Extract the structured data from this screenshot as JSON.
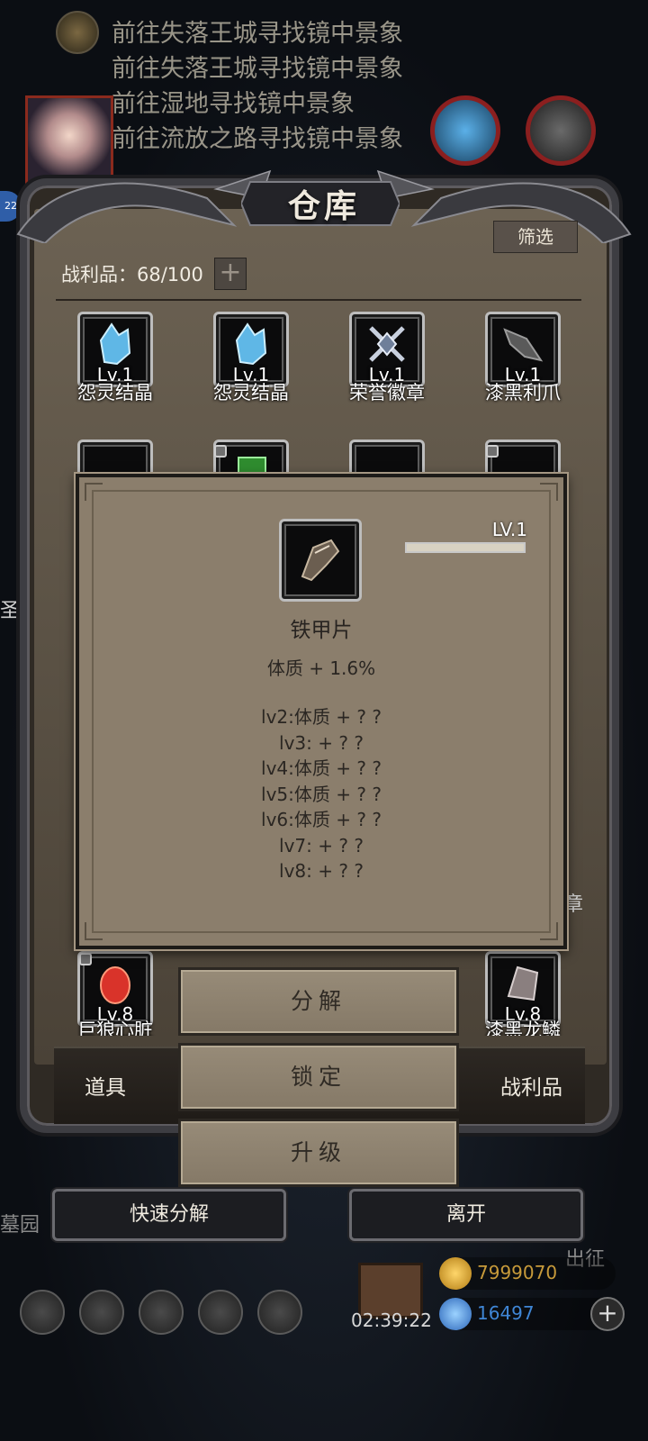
{
  "background": {
    "quests": [
      "前往失落王城寻找镜中景象",
      "前往失落王城寻找镜中景象",
      "前往湿地寻找镜中景象",
      "前往流放之路寻找镜中景象"
    ],
    "badge": "22",
    "left_place": "墓园",
    "right_label": "出征",
    "edge_text_left": "圣运",
    "edge_text_right": "章"
  },
  "panel": {
    "title": "仓库",
    "filter_label": "筛选",
    "loot_count_label": "战利品：68/100",
    "loot_plus": "+"
  },
  "items": {
    "row1": [
      {
        "name": "怨灵结晶",
        "level": "Lv.1",
        "icon": "blue-crystal-icon",
        "color": "#5fb7e6"
      },
      {
        "name": "怨灵结晶",
        "level": "Lv.1",
        "icon": "blue-crystal-icon",
        "color": "#5fb7e6"
      },
      {
        "name": "荣誉徽章",
        "level": "Lv.1",
        "icon": "crossed-swords-badge-icon",
        "color": "#aab4c8"
      },
      {
        "name": "漆黑利爪",
        "level": "Lv.1",
        "icon": "dark-claw-icon",
        "color": "#6a6a6a"
      }
    ],
    "row_bottom": [
      {
        "name": "巨狼心脏",
        "level": "Lv.8",
        "icon": "red-heart-icon",
        "color": "#d9332a"
      },
      {
        "name": "漆黑龙鳞",
        "level": "Lv.8",
        "icon": "dark-scale-icon",
        "color": "#8a7f7f"
      }
    ]
  },
  "tabs": {
    "items": "道具",
    "loot": "战利品"
  },
  "popup": {
    "level": "LV.1",
    "exp_fraction": 1.0,
    "name": "铁甲片",
    "icon": "iron-plate-icon",
    "stat": "体质 + 1.6%",
    "levels": [
      "lv2:体质 + ? ?",
      "lv3: + ? ?",
      "lv4:体质 + ? ?",
      "lv5:体质 + ? ?",
      "lv6:体质 + ? ?",
      "lv7: + ? ?",
      "lv8: + ? ?"
    ]
  },
  "actions": {
    "decompose": "分解",
    "lock": "锁定",
    "upgrade": "升级"
  },
  "bottom": {
    "quick_decompose": "快速分解",
    "leave": "离开"
  },
  "hud": {
    "timer": "02:39:22",
    "gold": "7999070",
    "gems": "16497",
    "plus": "+"
  },
  "colors": {
    "panel_bg": "#4a4237",
    "popup_bg": "#8b7e6c",
    "button_bg": "#8f8370",
    "gold_text": "#c79a3a",
    "gem_text": "#3f86d6"
  }
}
